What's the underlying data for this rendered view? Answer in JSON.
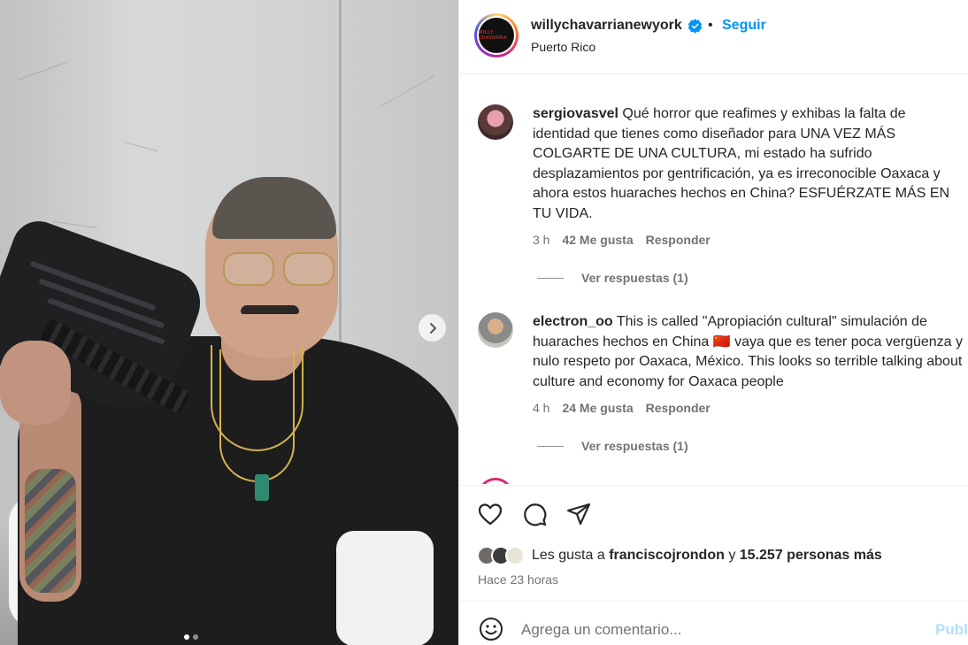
{
  "post": {
    "username": "willychavarrianewyork",
    "avatar_text": "WILLY CHAVARRIA",
    "separator": "•",
    "follow_label": "Seguir",
    "location": "Puerto Rico",
    "carousel_dots": 2,
    "carousel_active": 0
  },
  "comments": [
    {
      "username": "sergiovasvel",
      "text": "Qué horror que reafimes y exhibas la falta de identidad que tienes como diseñador para UNA VEZ MÁS COLGARTE DE UNA CULTURA, mi estado ha sufrido desplazamientos por gentrificación, ya es irreconocible Oaxaca y ahora estos huaraches hechos en China? ESFUÉRZATE MÁS EN TU VIDA.",
      "time": "3 h",
      "likes": "42 Me gusta",
      "reply_label": "Responder",
      "view_replies": "Ver respuestas (1)"
    },
    {
      "username": "electron_oo",
      "text": "This is called \"Apropiación cultural\" simulación de huaraches hechos en China 🇨🇳 vaya que es tener poca vergüenza y nulo respeto por Oaxaca, México. This looks so terrible talking about culture and economy for Oaxaca people",
      "time": "4 h",
      "likes": "24 Me gusta",
      "reply_label": "Responder",
      "view_replies": "Ver respuestas (1)"
    }
  ],
  "actions": {
    "likes_prefix": "Les gusta a",
    "liked_by": "franciscojrondon",
    "likes_joiner": "y",
    "others": "15.257 personas más",
    "time_ago": "Hace 23 horas"
  },
  "add_comment": {
    "placeholder": "Agrega un comentario...",
    "publish_label": "Publicar"
  },
  "icons": {
    "verified": "verified-badge-icon",
    "like": "heart-icon",
    "comment": "comment-bubble-icon",
    "share": "paper-plane-icon",
    "emoji": "smiley-icon",
    "next": "chevron-right-icon"
  },
  "colors": {
    "accent": "#0095f6",
    "text": "#262626",
    "muted": "#737373",
    "publish_disabled": "#b2dffc"
  }
}
